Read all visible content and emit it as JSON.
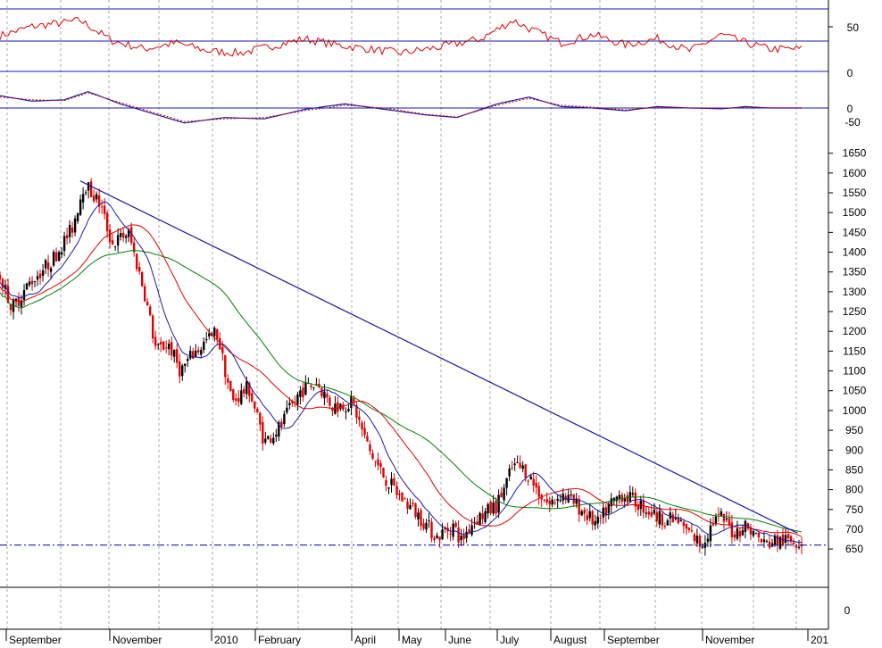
{
  "colors": {
    "background": "#ffffff",
    "up_candle": "#000000",
    "down_candle": "#e00000",
    "rsi_line": "#e00000",
    "macd_line": "#1a1aa8",
    "signal_line": "#e00000",
    "ma_fast": "#1a1aa8",
    "ma_mid": "#e00000",
    "ma_slow": "#008000",
    "trendline": "#1a1aa8",
    "support_line": "#1a1aa8",
    "guide_line": "#1a1aa8",
    "gridline": "#aaaaaa",
    "axis": "#000000"
  },
  "chart_data": [
    {
      "type": "line",
      "panel": "rsi",
      "y_ticks": [
        "50"
      ],
      "ylim": [
        20,
        90
      ],
      "reference_lines": [
        75,
        35
      ],
      "x": [
        0,
        0.04,
        0.08,
        0.1,
        0.14,
        0.18,
        0.22,
        0.26,
        0.3,
        0.34,
        0.38,
        0.42,
        0.46,
        0.5,
        0.55,
        0.6,
        0.64,
        0.66,
        0.7,
        0.74,
        0.78,
        0.82,
        0.86,
        0.9,
        0.93,
        0.96
      ],
      "series": [
        {
          "values": [
            55,
            64,
            68,
            70,
            50,
            42,
            48,
            40,
            38,
            45,
            52,
            46,
            42,
            38,
            44,
            52,
            70,
            62,
            48,
            56,
            46,
            52,
            40,
            56,
            48,
            42
          ]
        }
      ]
    },
    {
      "type": "line",
      "panel": "macd",
      "y_ticks": [
        "0",
        "0",
        "-50"
      ],
      "ylim": [
        -100,
        80
      ],
      "x": [
        0,
        0.04,
        0.08,
        0.11,
        0.15,
        0.19,
        0.23,
        0.28,
        0.33,
        0.38,
        0.43,
        0.48,
        0.53,
        0.57,
        0.62,
        0.66,
        0.7,
        0.74,
        0.78,
        0.82,
        0.86,
        0.9,
        0.93,
        0.96
      ],
      "series": [
        {
          "values": [
            40,
            20,
            25,
            55,
            10,
            -25,
            -60,
            -40,
            -45,
            -10,
            10,
            -10,
            -30,
            -40,
            10,
            35,
            0,
            -5,
            -15,
            0,
            -5,
            -8,
            0,
            -5
          ]
        },
        {
          "values": [
            35,
            25,
            22,
            50,
            15,
            -20,
            -55,
            -45,
            -40,
            -15,
            5,
            -5,
            -28,
            -38,
            5,
            30,
            5,
            -2,
            -12,
            -3,
            -4,
            -6,
            -2,
            -4
          ]
        }
      ]
    },
    {
      "type": "candlestick",
      "panel": "price",
      "y_ticks": [
        "1650",
        "1600",
        "1550",
        "1500",
        "1450",
        "1400",
        "1350",
        "1300",
        "1250",
        "1200",
        "1150",
        "1100",
        "1050",
        "1000",
        "950",
        "900",
        "850",
        "800",
        "750",
        "700",
        "650"
      ],
      "ylim": [
        630,
        1665
      ],
      "x_labels": [
        "September",
        "November",
        "2010",
        "February",
        "April",
        "May",
        "June",
        "July",
        "August",
        "September",
        "November",
        "201"
      ],
      "anchors_t": [
        0,
        0.015,
        0.04,
        0.065,
        0.09,
        0.105,
        0.125,
        0.14,
        0.16,
        0.18,
        0.195,
        0.21,
        0.225,
        0.24,
        0.27,
        0.29,
        0.31,
        0.33,
        0.35,
        0.375,
        0.395,
        0.415,
        0.44,
        0.46,
        0.48,
        0.5,
        0.52,
        0.545,
        0.565,
        0.575,
        0.59,
        0.62,
        0.64,
        0.655,
        0.67,
        0.685,
        0.7,
        0.72,
        0.735,
        0.745,
        0.76,
        0.775,
        0.8,
        0.82,
        0.845,
        0.86,
        0.875,
        0.89,
        0.9,
        0.915,
        0.93,
        0.945,
        0.955,
        0.965
      ],
      "anchors_price": [
        1340,
        1260,
        1330,
        1380,
        1460,
        1575,
        1520,
        1420,
        1450,
        1300,
        1150,
        1170,
        1100,
        1140,
        1200,
        1020,
        1060,
        920,
        960,
        1050,
        1070,
        1010,
        1020,
        900,
        830,
        780,
        740,
        680,
        710,
        670,
        720,
        760,
        860,
        850,
        800,
        760,
        790,
        760,
        730,
        710,
        760,
        790,
        760,
        730,
        720,
        690,
        660,
        720,
        730,
        690,
        710,
        680,
        660,
        670
      ],
      "indicators": [
        "ma_fast",
        "ma_mid",
        "ma_slow"
      ],
      "trendline": {
        "from": [
          0.1,
          1580
        ],
        "to": [
          0.995,
          690
        ]
      },
      "support_level": 660
    },
    {
      "type": "bar",
      "panel": "volume",
      "y_ticks": [
        "0"
      ],
      "values": []
    }
  ]
}
